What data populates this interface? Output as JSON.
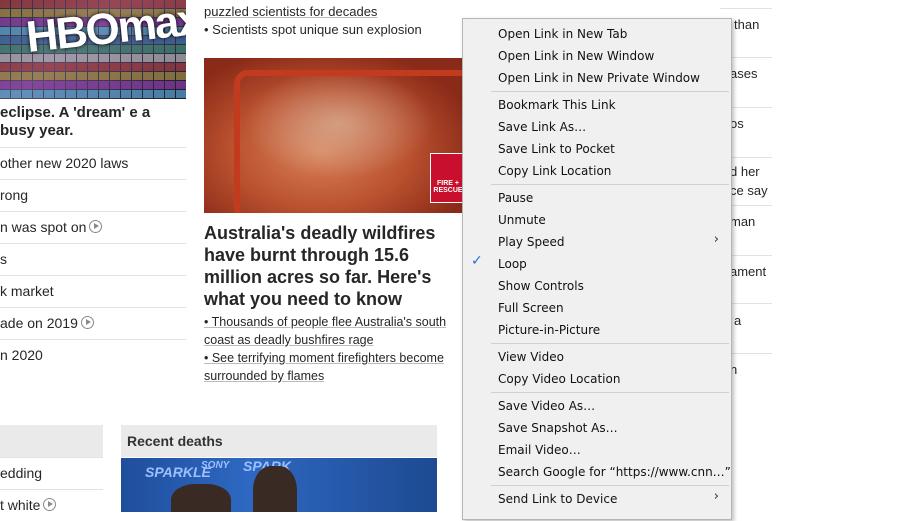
{
  "left": {
    "logo_text": "HBOmax",
    "headline": "eclipse. A 'dream' e a busy year.",
    "rows": [
      {
        "text": "other new 2020 laws",
        "play": false
      },
      {
        "text": "rong",
        "play": false
      },
      {
        "text": "n was spot on",
        "play": true
      },
      {
        "text": "s",
        "play": false
      },
      {
        "text": "k market",
        "play": false
      },
      {
        "text": "ade on 2019",
        "play": true
      },
      {
        "text": "n 2020",
        "play": false
      }
    ],
    "bottom_rows": [
      {
        "text": "edding",
        "play": false
      },
      {
        "text": "t white",
        "play": true
      }
    ]
  },
  "middle": {
    "top_line": "puzzled scientists for decades",
    "top_bullet": "• Scientists spot unique sun explosion",
    "badge_text": "FIRE + RESCUE",
    "headline": "Australia's deadly wildfires have burnt through 15.6 million acres so far. Here's what you need to know",
    "bullet1": "• Thousands of people flee Australia's south coast as deadly bushfires rage",
    "bullet2": "• See terrifying moment firefighters become surrounded by flames",
    "section_title": "Recent deaths",
    "photo_text1": "SPARKLE",
    "photo_text2": "SONY",
    "photo_text3": "SPARK"
  },
  "right": {
    "items": [
      "than",
      "ases",
      "os",
      "d her",
      "ce say",
      "man",
      "ament",
      "a",
      "n"
    ]
  },
  "context_menu": {
    "items": [
      {
        "label": "Open Link in New Tab",
        "submenu": false,
        "checked": false
      },
      {
        "label": "Open Link in New Window",
        "submenu": false,
        "checked": false
      },
      {
        "label": "Open Link in New Private Window",
        "submenu": false,
        "checked": false
      },
      {
        "label": "Bookmark This Link",
        "submenu": false,
        "checked": false
      },
      {
        "label": "Save Link As…",
        "submenu": false,
        "checked": false
      },
      {
        "label": "Save Link to Pocket",
        "submenu": false,
        "checked": false
      },
      {
        "label": "Copy Link Location",
        "submenu": false,
        "checked": false
      },
      {
        "label": "Pause",
        "submenu": false,
        "checked": false
      },
      {
        "label": "Unmute",
        "submenu": false,
        "checked": false
      },
      {
        "label": "Play Speed",
        "submenu": true,
        "checked": false
      },
      {
        "label": "Loop",
        "submenu": false,
        "checked": true
      },
      {
        "label": "Show Controls",
        "submenu": false,
        "checked": false
      },
      {
        "label": "Full Screen",
        "submenu": false,
        "checked": false
      },
      {
        "label": "Picture-in-Picture",
        "submenu": false,
        "checked": false
      },
      {
        "label": "View Video",
        "submenu": false,
        "checked": false
      },
      {
        "label": "Copy Video Location",
        "submenu": false,
        "checked": false
      },
      {
        "label": "Save Video As…",
        "submenu": false,
        "checked": false
      },
      {
        "label": "Save Snapshot As…",
        "submenu": false,
        "checked": false
      },
      {
        "label": "Email Video…",
        "submenu": false,
        "checked": false
      },
      {
        "label": "Search Google for “https://www.cnn…”",
        "submenu": false,
        "checked": false
      },
      {
        "label": "Send Link to Device",
        "submenu": true,
        "checked": false
      }
    ],
    "check_icon": "check-icon",
    "submenu_icon": "chevron-right-icon"
  },
  "colors": {
    "check": "#2a6fd6",
    "menu_bg": "#f0f0f0",
    "badge": "#c8102e"
  }
}
